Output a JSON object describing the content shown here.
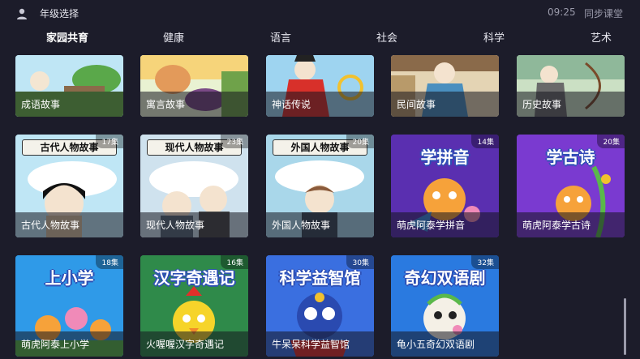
{
  "header": {
    "grade_label": "年级选择",
    "time": "09:25",
    "sync_label": "同步课堂"
  },
  "categories": [
    "家园共育",
    "健康",
    "语言",
    "社会",
    "科学",
    "艺术"
  ],
  "active_category": "家园共育",
  "rows": [
    [
      {
        "title": "成语故事"
      },
      {
        "title": "寓言故事"
      },
      {
        "title": "神话传说"
      },
      {
        "title": "民间故事"
      },
      {
        "title": "历史故事"
      }
    ],
    [
      {
        "title": "古代人物故事",
        "banner": "古代人物故事",
        "episodes": "17集"
      },
      {
        "title": "现代人物故事",
        "banner": "现代人物故事",
        "episodes": "23集"
      },
      {
        "title": "外国人物故事",
        "banner": "外国人物故事",
        "episodes": "20集"
      },
      {
        "title": "萌虎阿泰学拼音",
        "banner": "学拼音",
        "episodes": "14集"
      },
      {
        "title": "萌虎阿泰学古诗",
        "banner": "学古诗",
        "episodes": "20集"
      }
    ],
    [
      {
        "title": "萌虎阿泰上小学",
        "banner": "上小学",
        "episodes": "18集"
      },
      {
        "title": "火喔喔汉字奇遇记",
        "banner": "汉字奇遇记",
        "episodes": "16集"
      },
      {
        "title": "牛呆呆科学益智馆",
        "banner": "科学益智馆",
        "episodes": "30集"
      },
      {
        "title": "龟小五奇幻双语剧",
        "banner": "奇幻双语剧",
        "episodes": "32集"
      }
    ]
  ],
  "colors": {
    "background": "#1c1c2a",
    "caption_overlay": "#14141e",
    "tile_sky": "#bfe6f5",
    "tile_blue": "#3a6fe0",
    "tile_green": "#2f8a4a",
    "tile_purple": "#5a2fb0"
  }
}
